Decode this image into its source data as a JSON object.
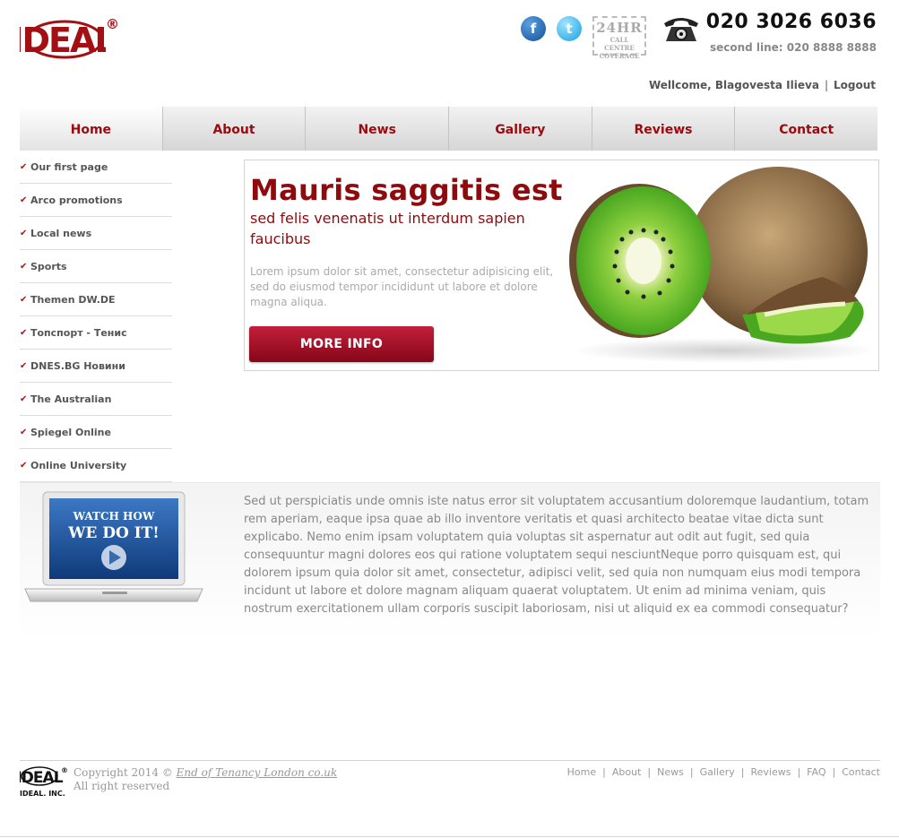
{
  "brand": {
    "logo_text": "IDEAL",
    "registered": "®",
    "colors": {
      "brand_red": "#a30f12",
      "nav_text": "#9b0a0f"
    }
  },
  "header": {
    "social": [
      {
        "icon": "facebook-icon",
        "glyph": "f"
      },
      {
        "icon": "twitter-icon",
        "glyph": "t"
      }
    ],
    "badge": {
      "line1": "24HR",
      "line2": "CALL CENTRE",
      "line3": "COVERAGE"
    },
    "phone_main": "020 3026 6036",
    "phone_second": "second line: 020 8888 8888",
    "welcome": "Wellcome, Blagovesta Ilieva",
    "separator": "|",
    "logout": "Logout"
  },
  "nav": [
    {
      "label": "Home",
      "active": true
    },
    {
      "label": "About"
    },
    {
      "label": "News"
    },
    {
      "label": "Gallery"
    },
    {
      "label": "Reviews"
    },
    {
      "label": "Contact"
    }
  ],
  "sidebar": {
    "check_glyph": "✔",
    "items": [
      "Our first page",
      "Arco promotions",
      "Local news",
      "Sports",
      "Themen DW.DE",
      "Топспорт - Тенис",
      "DNES.BG Новини",
      "The Australian",
      "Spiegel Online",
      "Online University"
    ]
  },
  "banner": {
    "title": "Mauris saggitis est",
    "subtitle": "sed felis venenatis ut interdum sapien faucibus",
    "text": "Lorem ipsum dolor sit amet, consectetur adipisicing elit, sed do eiusmod tempor incididunt ut labore et dolore magna aliqua.",
    "button": "MORE INFO"
  },
  "promo": {
    "video_line1": "WATCH HOW",
    "video_line2": "WE DO IT!",
    "text": "Sed ut perspiciatis unde omnis iste natus error sit voluptatem accusantium doloremque laudantium, totam rem aperiam, eaque ipsa quae ab illo inventore veritatis et quasi architecto beatae vitae dicta sunt explicabo. Nemo enim ipsam voluptatem quia voluptas sit aspernatur aut odit aut fugit, sed quia consequuntur magni dolores eos qui ratione voluptatem sequi nesciuntNeque porro quisquam est, qui dolorem ipsum quia dolor sit amet, consectetur, adipisci velit, sed quia non numquam eius modi tempora incidunt ut labore et dolore magnam aliquam quaerat voluptatem. Ut enim ad minima veniam, quis nostrum exercitationem ullam corporis suscipit laboriosam, nisi ut aliquid ex ea commodi consequatur?"
  },
  "footer": {
    "logo_text": "IDEAL",
    "logo_caption": "IDEAL. INC.",
    "copyright_prefix": "Copyright 2014 ©",
    "copyright_link": "End of Tenancy London co.uk",
    "rights": "All right reserved",
    "links": [
      "Home",
      "About",
      "News",
      "Gallery",
      "Reviews",
      "FAQ",
      "Contact"
    ],
    "separator": "|"
  }
}
